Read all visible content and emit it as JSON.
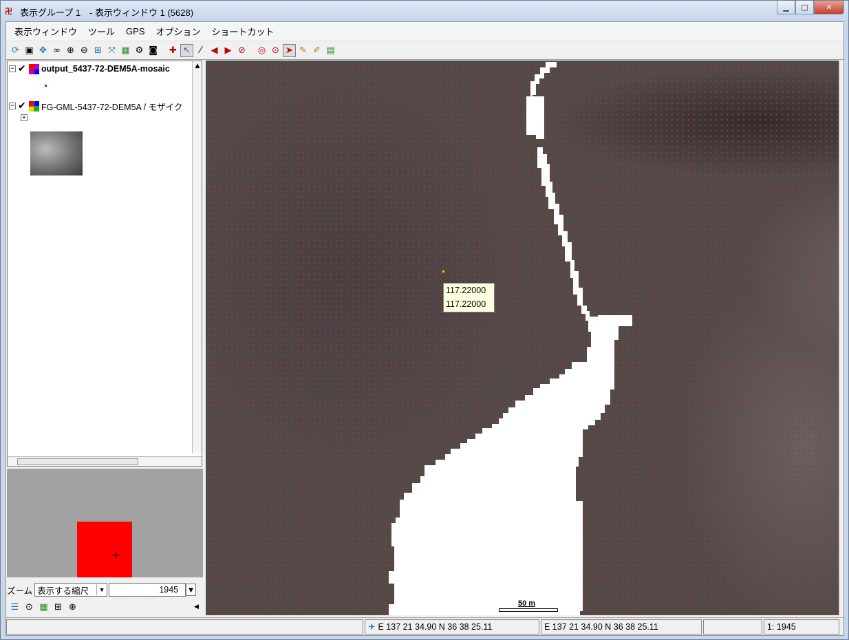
{
  "window": {
    "title": "表示グループ 1　- 表示ウィンドウ 1 (5628)",
    "buttons": {
      "minimize": "▁",
      "maximize": "□",
      "close": "✕"
    }
  },
  "menu": {
    "items": [
      "表示ウィンドウ",
      "ツール",
      "GPS",
      "オプション",
      "ショートカット"
    ]
  },
  "layers": [
    {
      "name": "output_5437-72-DEM5A-mosaic",
      "checked": true,
      "expander": "⊟"
    },
    {
      "name": "FG-GML-5437-72-DEM5A / モザイク",
      "checked": true,
      "expander": "⊟"
    }
  ],
  "zoom": {
    "label": "ズーム",
    "mode": "表示する縮尺",
    "scale": "1945"
  },
  "map": {
    "tooltip_line1": "117.22000",
    "tooltip_line2": "117.22000",
    "scale_label": "50 m",
    "colors": {
      "terrain": "#4e4b4b",
      "dots": "#d42020",
      "water": "#ffffff"
    }
  },
  "status": {
    "coord1": "E 137 21 34.90  N 36 38 25.11",
    "coord2": "E 137 21 34.90  N 36 38 25.11",
    "scale": "1: 1945"
  }
}
